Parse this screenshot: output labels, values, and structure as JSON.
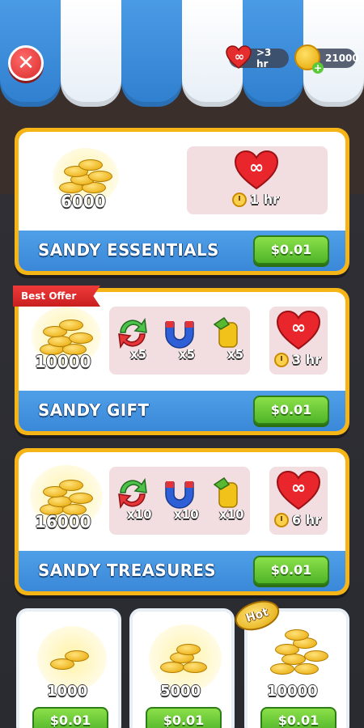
{
  "header": {
    "close_label": "✕",
    "lives_value": ">3 hr",
    "coins_value": "21000"
  },
  "offers": [
    {
      "title": "SANDY ESSENTIALS",
      "coins": "6000",
      "lives_time": "1 hr",
      "price": "$0.01"
    },
    {
      "badge": "Best Offer",
      "title": "SANDY GIFT",
      "coins": "10000",
      "boosters": [
        "x5",
        "x5",
        "x5"
      ],
      "lives_time": "3 hr",
      "price": "$0.01"
    },
    {
      "title": "SANDY TREASURES",
      "coins": "16000",
      "boosters": [
        "x10",
        "x10",
        "x10"
      ],
      "lives_time": "6 hr",
      "price": "$0.01"
    }
  ],
  "coin_packs": [
    {
      "amount": "1000",
      "price": "$0.01"
    },
    {
      "amount": "5000",
      "price": "$0.01"
    },
    {
      "amount": "10000",
      "price": "$0.01",
      "badge": "Hot"
    }
  ],
  "icons": {
    "infinity": "∞",
    "heart": "heart-icon",
    "coin": "coin-icon",
    "clock": "clock-icon",
    "shuffle": "shuffle-icon",
    "magnet": "magnet-icon",
    "hammer": "hammer-icon"
  },
  "colors": {
    "awning_blue": "#3a88d8",
    "card_border": "#f6b516",
    "title_bar": "#3a88d8",
    "price_button": "#4fb428",
    "badge_red": "#d92b2b"
  }
}
